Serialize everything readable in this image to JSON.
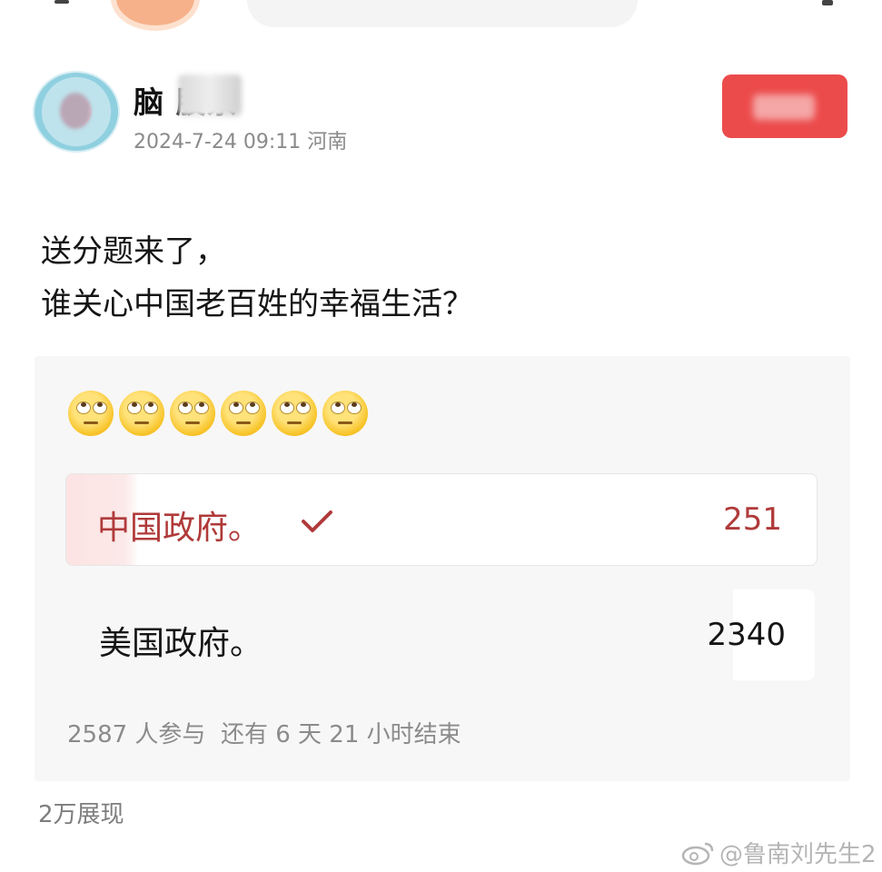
{
  "author": {
    "name": "脑   股票",
    "timestamp": "2024-7-24 09:11",
    "location": "河南"
  },
  "post": {
    "lines": [
      "送分题来了，",
      "谁关心中国老百姓的幸福生活？"
    ],
    "emoji": "face-with-rolling-eyes",
    "emoji_count": 6
  },
  "poll": {
    "options": [
      {
        "label": "中国政府。",
        "count": "251",
        "selected": true,
        "share": 0.097
      },
      {
        "label": "美国政府。",
        "count": "2340",
        "selected": false,
        "share": 0.903
      }
    ],
    "participants_text": "2587 人参与",
    "remaining_text": "还有 6 天 21 小时结束"
  },
  "stats": {
    "views": "2万展现"
  },
  "watermark": "@鲁南刘先生2",
  "colors": {
    "accent": "#ec4b4b",
    "selected_text": "#b03a3a",
    "muted": "#8b8b8b"
  }
}
